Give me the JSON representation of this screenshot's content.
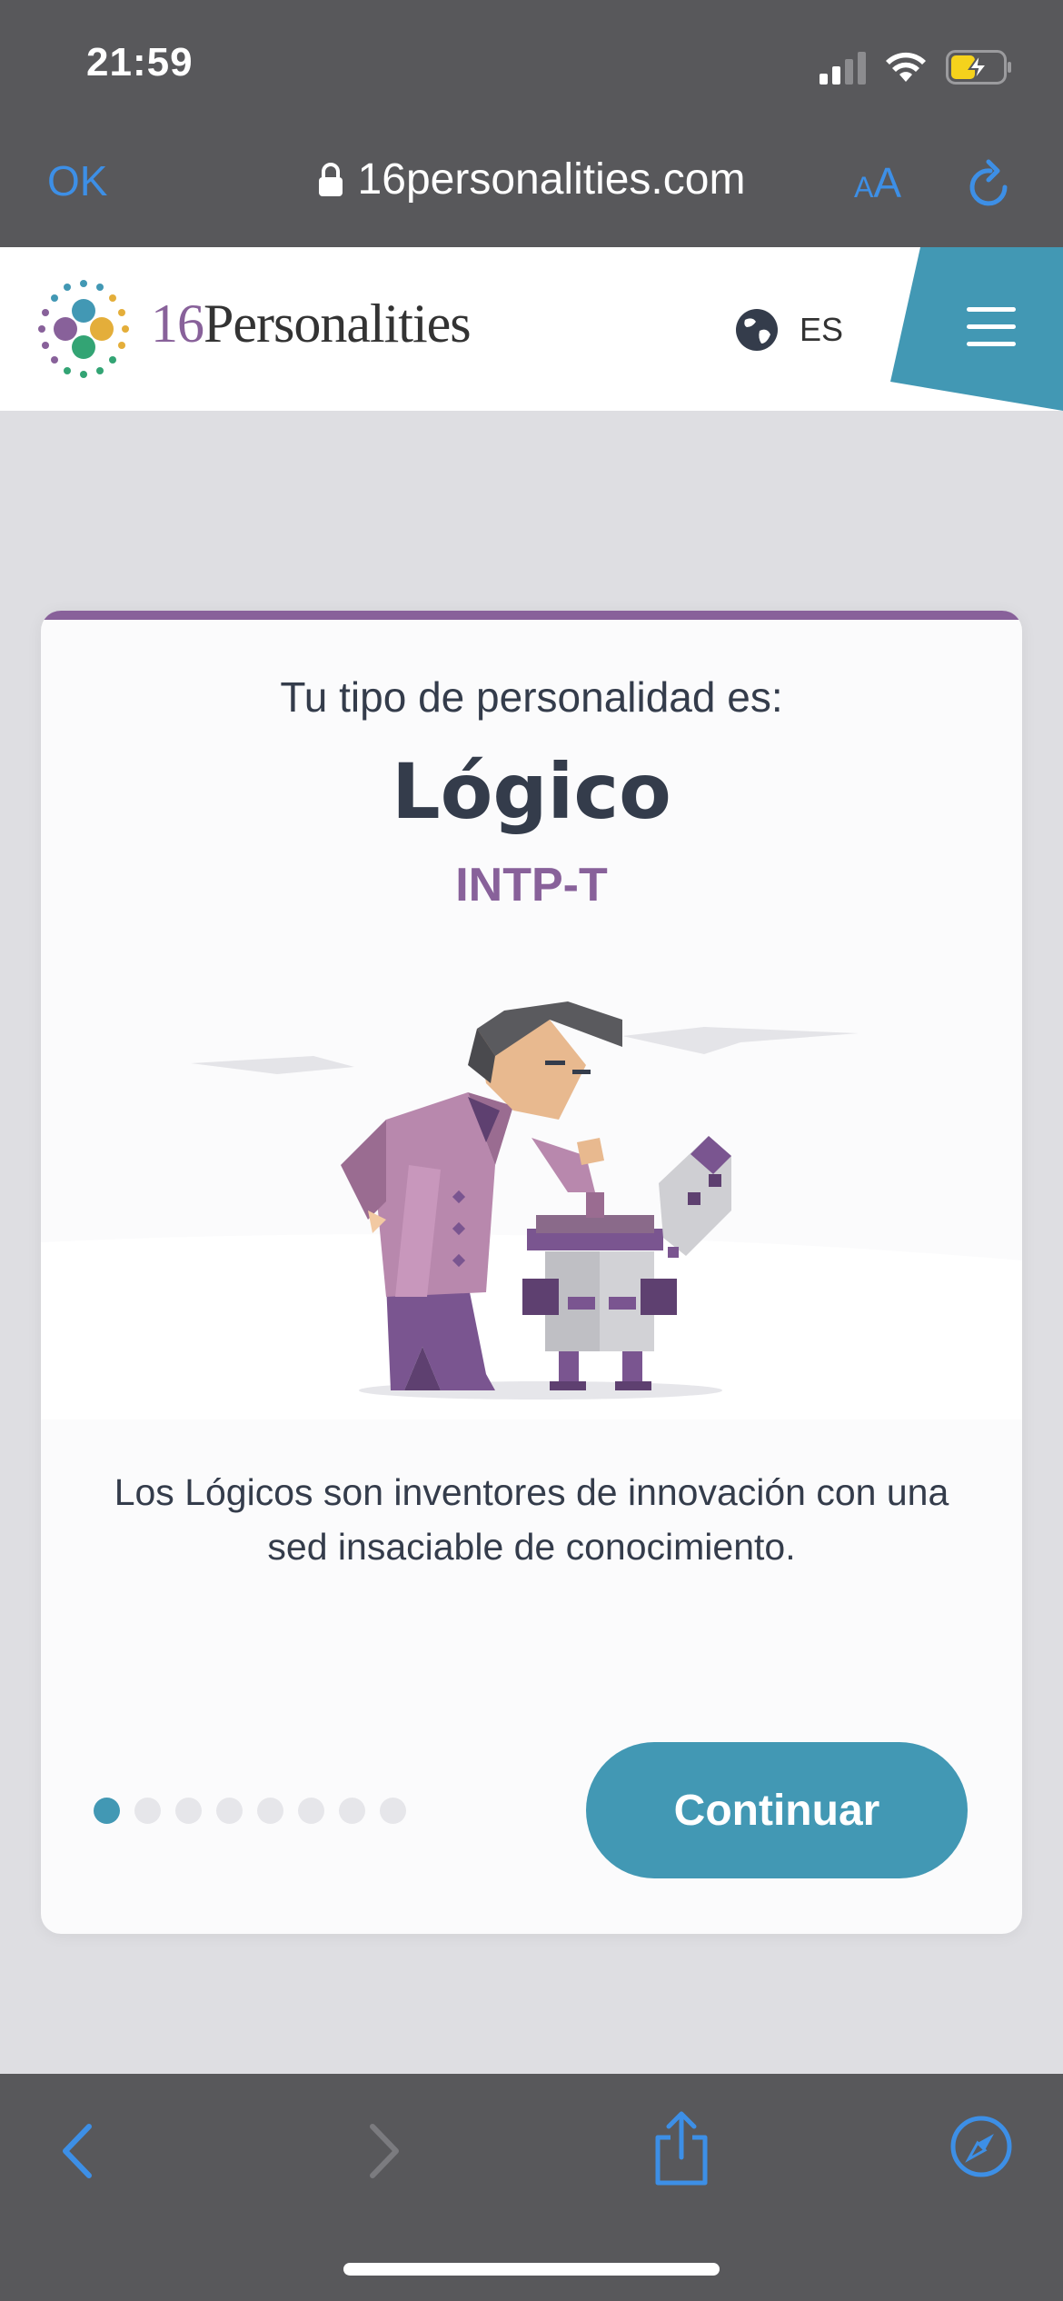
{
  "status_bar": {
    "time": "21:59",
    "icons": [
      "cellular-signal-icon",
      "wifi-icon",
      "battery-charging-icon"
    ]
  },
  "browser": {
    "ok_label": "OK",
    "url": "16personalities.com",
    "text_size_small": "A",
    "text_size_large": "A",
    "icons": [
      "lock-icon",
      "reload-icon"
    ]
  },
  "site_header": {
    "brand_number": "16",
    "brand_word": "Personalities",
    "language": "ES",
    "icons": [
      "logo-dots-icon",
      "globe-icon",
      "hamburger-menu-icon"
    ]
  },
  "card": {
    "intro": "Tu tipo de personalidad es:",
    "type_name": "Lógico",
    "type_code": "INTP-T",
    "description": "Los Lógicos son inventores de innovación con una sed insaciable de conocimiento.",
    "continue_label": "Continuar",
    "pagination": {
      "total": 8,
      "current": 1
    }
  },
  "toolbar": {
    "icons": [
      "back-icon",
      "forward-icon",
      "share-icon",
      "compass-icon"
    ]
  },
  "colors": {
    "purple": "#88619a",
    "teal": "#4298b4",
    "ios_blue": "#3d8fe6",
    "chrome_gray": "#58585b",
    "text_dark": "#343c4b"
  }
}
